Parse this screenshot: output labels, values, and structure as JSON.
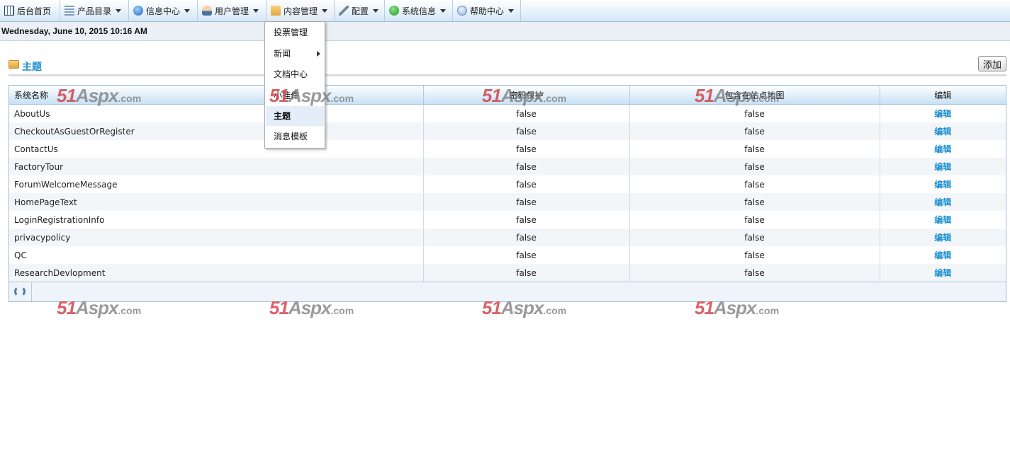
{
  "menu": [
    {
      "label": "后台首页",
      "icon": "home-icon",
      "has_dropdown": false
    },
    {
      "label": "产品目录",
      "icon": "catalog-icon",
      "has_dropdown": true
    },
    {
      "label": "信息中心",
      "icon": "info-icon",
      "has_dropdown": true
    },
    {
      "label": "用户管理",
      "icon": "user-icon",
      "has_dropdown": true
    },
    {
      "label": "内容管理",
      "icon": "folder-icon",
      "has_dropdown": true
    },
    {
      "label": "配置",
      "icon": "wrench-icon",
      "has_dropdown": true
    },
    {
      "label": "系统信息",
      "icon": "status-icon",
      "has_dropdown": true
    },
    {
      "label": "帮助中心",
      "icon": "help-icon",
      "has_dropdown": true
    }
  ],
  "content_menu": {
    "items": [
      {
        "label": "投票管理"
      },
      {
        "label": "新闻",
        "has_submenu": true
      },
      {
        "label": "文档中心"
      },
      {
        "label": "小挂件"
      },
      {
        "label": "主题"
      },
      {
        "label": "消息模板"
      }
    ]
  },
  "datebar": {
    "text": "Wednesday, June 10, 2015 10:16 AM"
  },
  "page": {
    "title": "主题",
    "add_label": "添加"
  },
  "grid": {
    "columns": [
      "系统名称",
      "密码保护",
      "包含在站点地图",
      "编辑"
    ],
    "rows": [
      {
        "name": "AboutUs",
        "password_protected": "false",
        "in_sitemap": "false",
        "edit": "编辑"
      },
      {
        "name": "CheckoutAsGuestOrRegister",
        "password_protected": "false",
        "in_sitemap": "false",
        "edit": "编辑"
      },
      {
        "name": "ContactUs",
        "password_protected": "false",
        "in_sitemap": "false",
        "edit": "编辑"
      },
      {
        "name": "FactoryTour",
        "password_protected": "false",
        "in_sitemap": "false",
        "edit": "编辑"
      },
      {
        "name": "ForumWelcomeMessage",
        "password_protected": "false",
        "in_sitemap": "false",
        "edit": "编辑"
      },
      {
        "name": "HomePageText",
        "password_protected": "false",
        "in_sitemap": "false",
        "edit": "编辑"
      },
      {
        "name": "LoginRegistrationInfo",
        "password_protected": "false",
        "in_sitemap": "false",
        "edit": "编辑"
      },
      {
        "name": "privacypolicy",
        "password_protected": "false",
        "in_sitemap": "false",
        "edit": "编辑"
      },
      {
        "name": "QC",
        "password_protected": "false",
        "in_sitemap": "false",
        "edit": "编辑"
      },
      {
        "name": "ResearchDevlopment",
        "password_protected": "false",
        "in_sitemap": "false",
        "edit": "编辑"
      }
    ]
  },
  "watermark": {
    "main": "51",
    "mid": "Aspx",
    "domain": ".com"
  },
  "colors": {
    "accent": "#1a8fd0",
    "watermark_red": "#cd373c",
    "grid_border": "#99bbdd"
  }
}
